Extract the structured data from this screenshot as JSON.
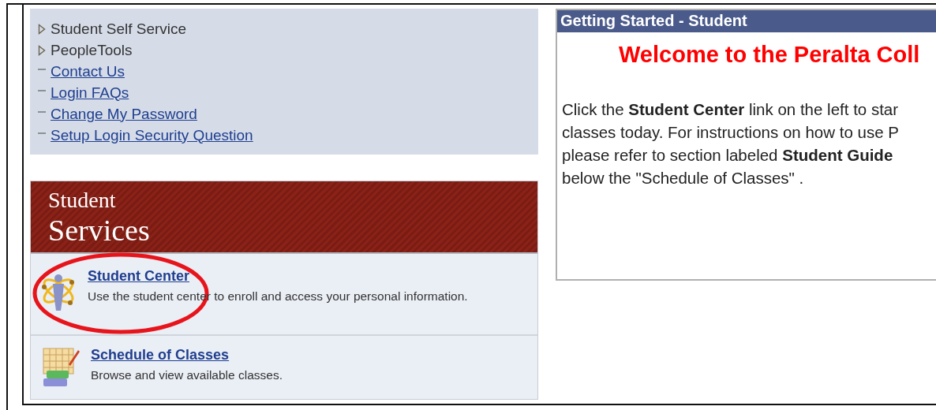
{
  "menu": {
    "items": [
      {
        "kind": "folder",
        "label": "Student Self Service",
        "expanded": false
      },
      {
        "kind": "folder",
        "label": "PeopleTools",
        "expanded": false
      },
      {
        "kind": "link",
        "label": "Contact Us"
      },
      {
        "kind": "link",
        "label": "Login FAQs"
      },
      {
        "kind": "link",
        "label": "Change My Password"
      },
      {
        "kind": "link",
        "label": "Setup Login Security Question"
      }
    ]
  },
  "services": {
    "title_top": "Student",
    "title_bottom": "Services",
    "items": [
      {
        "kind": "student",
        "title": "Student Center",
        "description": "Use the student center to enroll and access your personal information.",
        "circled": true
      },
      {
        "kind": "schedule",
        "title": "Schedule of Classes",
        "description": "Browse and view available classes.",
        "circled": false
      }
    ]
  },
  "getting_started": {
    "title": "Getting Started - Student",
    "welcome": "Welcome to the Peralta Coll",
    "lines": [
      "Click the **Student Center** link on the left to star",
      "classes today. For instructions on how to use P",
      "please refer to section labeled **Student Guide**",
      "below the \"Schedule of Classes\" ."
    ]
  }
}
